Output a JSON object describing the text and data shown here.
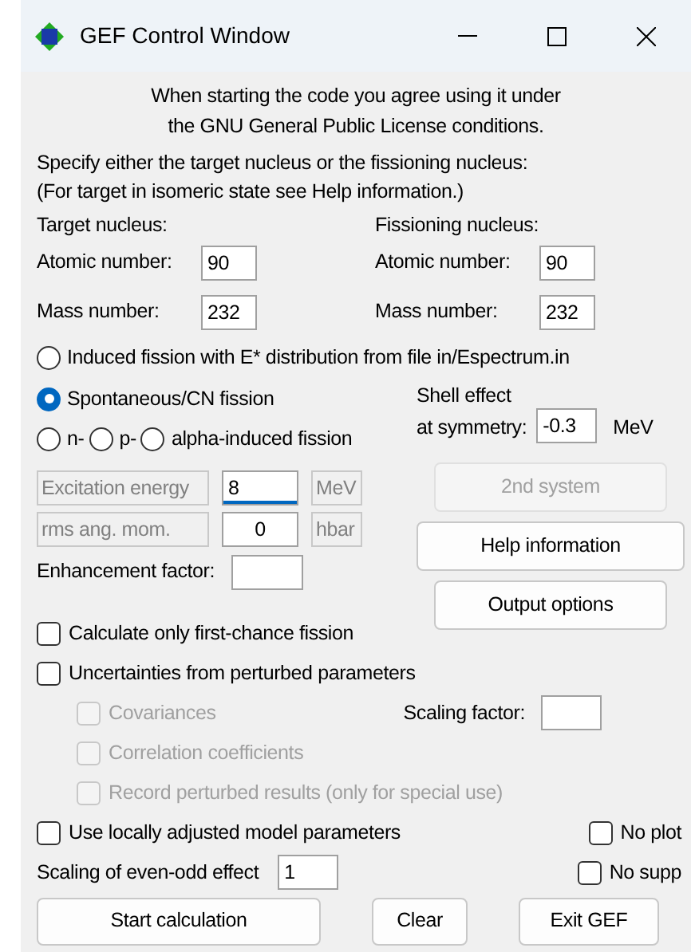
{
  "window": {
    "title": "GEF Control Window"
  },
  "notice": [
    "When starting the code you agree using it under",
    "the GNU General Public License conditions."
  ],
  "instructions": [
    "Specify either the target nucleus or the fissioning nucleus:",
    "(For target in isomeric state see Help information.)"
  ],
  "nuclei": [
    {
      "heading": "Target nucleus:",
      "fields": [
        {
          "label": "Atomic number:",
          "value": "90"
        },
        {
          "label": "Mass number:",
          "value": "232"
        }
      ]
    },
    {
      "heading": "Fissioning nucleus:",
      "fields": [
        {
          "label": "Atomic number:",
          "value": "90"
        },
        {
          "label": "Mass number:",
          "value": "232"
        }
      ]
    }
  ],
  "fission_modes": [
    [
      {
        "label": "Induced fission with E* distribution from file in/Espectrum.in",
        "selected": false
      }
    ],
    [
      {
        "label": "Spontaneous/CN fission",
        "selected": true
      }
    ],
    [
      {
        "label": "n-",
        "selected": false
      },
      {
        "label": "p-",
        "selected": false
      },
      {
        "label": "alpha-induced fission",
        "selected": false
      }
    ]
  ],
  "shell_effect": {
    "label_lines": [
      "Shell effect",
      "at symmetry:"
    ],
    "value": "-0.3",
    "unit": "MeV"
  },
  "excitation": [
    {
      "label": "Excitation energy",
      "value": "8",
      "unit": "MeV",
      "focused": true
    },
    {
      "label": "rms ang. mom.",
      "value": "0",
      "unit": "hbar",
      "focused": false
    }
  ],
  "enhancement": {
    "label": "Enhancement factor:"
  },
  "side_buttons": [
    {
      "label": "2nd system",
      "disabled": true
    },
    {
      "label": "Help information",
      "disabled": false
    },
    {
      "label": "Output options",
      "disabled": false
    }
  ],
  "options": [
    {
      "label": "Calculate only first-chance fission",
      "checked": false,
      "disabled": false
    },
    {
      "label": "Uncertainties from perturbed parameters",
      "checked": false,
      "disabled": false,
      "children": [
        {
          "label": "Covariances",
          "checked": false,
          "disabled": true
        },
        {
          "label": "Correlation coefficients",
          "checked": false,
          "disabled": true
        },
        {
          "label": "Record perturbed results (only for special use)",
          "checked": false,
          "disabled": true
        }
      ]
    }
  ],
  "scaling_factor": {
    "label": "Scaling factor:"
  },
  "local_params": {
    "label": "Use locally adjusted model parameters",
    "checked": false,
    "disabled": false
  },
  "no_plot": {
    "label": "No plot",
    "checked": false,
    "disabled": false
  },
  "even_odd": {
    "label": "Scaling of even-odd effect",
    "value": "1"
  },
  "no_supp": {
    "label": "No supp",
    "checked": false,
    "disabled": false
  },
  "buttons": [
    "Start calculation",
    "Clear",
    "Exit GEF"
  ]
}
